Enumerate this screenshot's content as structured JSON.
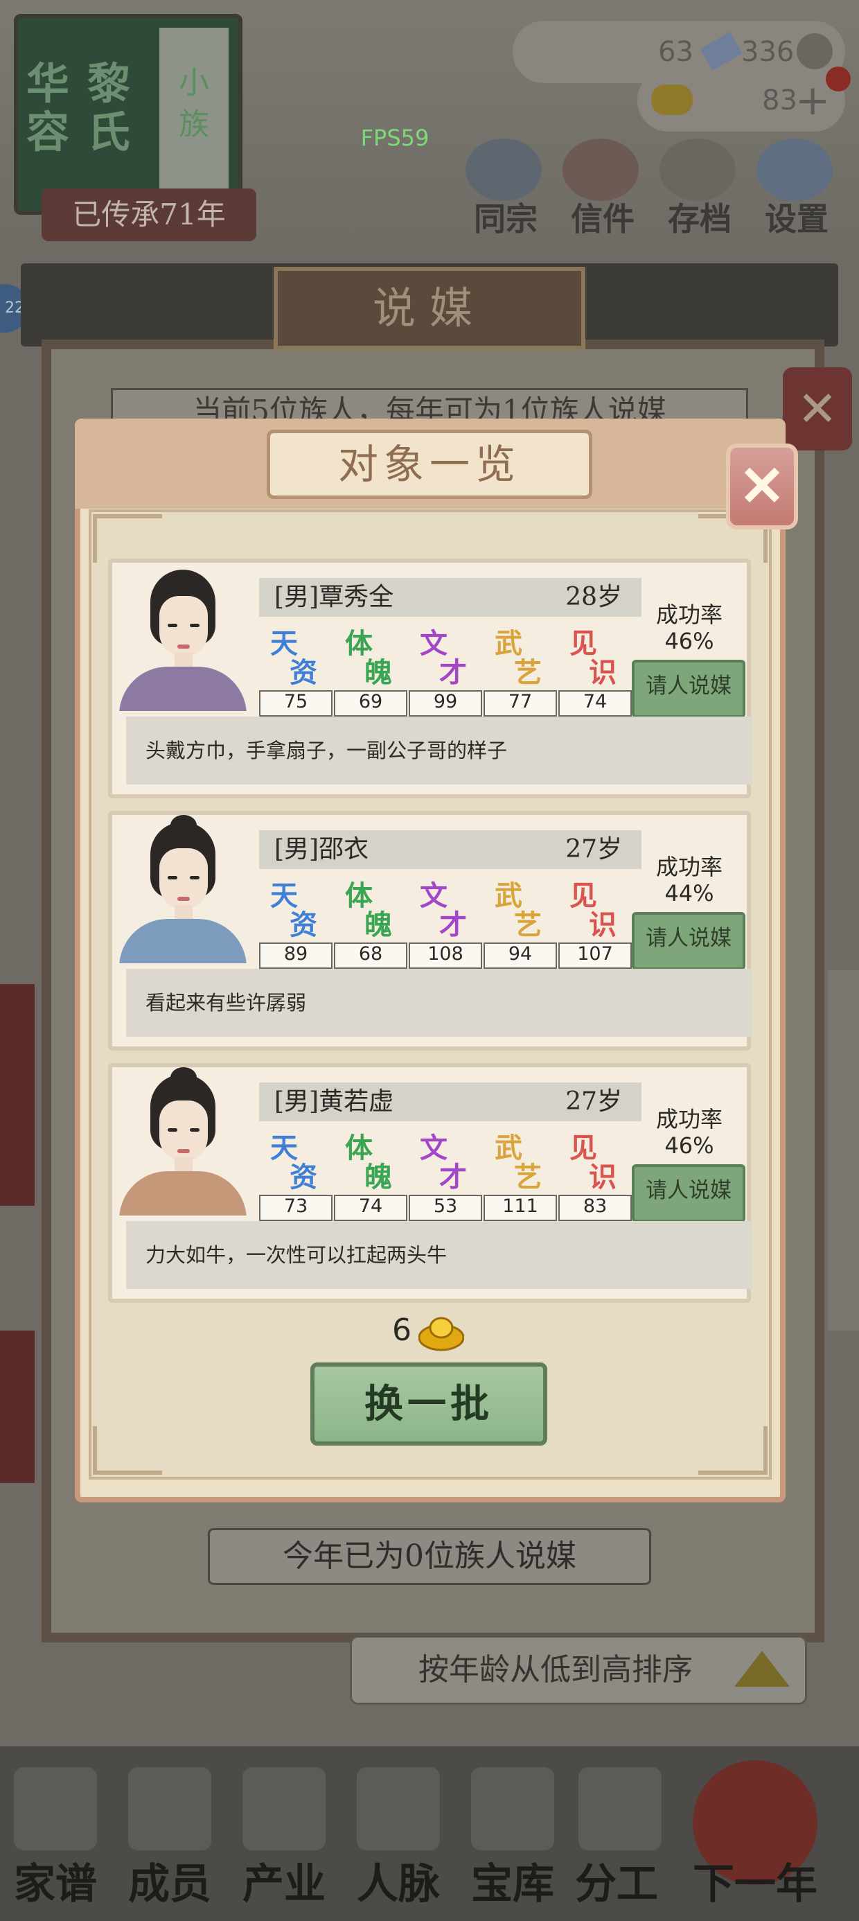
{
  "hud": {
    "clan_name_1": "华容",
    "clan_name_2": "黎氏",
    "clan_tag": "小族",
    "clan_years": "已传承71年",
    "fps": "FPS59",
    "resource_a": "63",
    "resource_b": "336",
    "gold": "83",
    "notification_badge": "22"
  },
  "top_menu": [
    {
      "label": "同宗",
      "icon": "clan-icon"
    },
    {
      "label": "信件",
      "icon": "letter-icon"
    },
    {
      "label": "存档",
      "icon": "save-icon"
    },
    {
      "label": "设置",
      "icon": "settings-icon"
    }
  ],
  "outer_dialog": {
    "title": "说媒",
    "subtitle": "当前5位族人，每年可为1位族人说媒",
    "footer": "今年已为0位族人说媒",
    "sort_label": "按年龄从低到高排序"
  },
  "dialog": {
    "title": "对象一览",
    "refresh_cost": "6",
    "refresh_label": "换一批"
  },
  "stat_labels": [
    {
      "a": "天",
      "b": "资",
      "color": "#3f7fd6"
    },
    {
      "a": "体",
      "b": "魄",
      "color": "#3aa552"
    },
    {
      "a": "文",
      "b": "才",
      "color": "#a347c9"
    },
    {
      "a": "武",
      "b": "艺",
      "color": "#d9a43b"
    },
    {
      "a": "见",
      "b": "识",
      "color": "#d9534f"
    }
  ],
  "rate_label": "成功率",
  "invite_label": "请人说媒",
  "candidates": [
    {
      "name": "[男]覃秀全",
      "age": "28岁",
      "rate": "46%",
      "stats": [
        "75",
        "69",
        "99",
        "77",
        "74"
      ],
      "desc": "头戴方巾，手拿扇子，一副公子哥的样子",
      "robe_color": "#8c7aa3"
    },
    {
      "name": "[男]邵衣",
      "age": "27岁",
      "rate": "44%",
      "stats": [
        "89",
        "68",
        "108",
        "94",
        "107"
      ],
      "desc": "看起来有些许孱弱",
      "robe_color": "#7c9bbd"
    },
    {
      "name": "[男]黄若虚",
      "age": "27岁",
      "rate": "46%",
      "stats": [
        "73",
        "74",
        "53",
        "111",
        "83"
      ],
      "desc": "力大如牛，一次性可以扛起两头牛",
      "robe_color": "#c49878"
    }
  ],
  "bottom_nav": [
    "家谱",
    "成员",
    "产业",
    "人脉",
    "宝库",
    "分工",
    "下一年"
  ]
}
